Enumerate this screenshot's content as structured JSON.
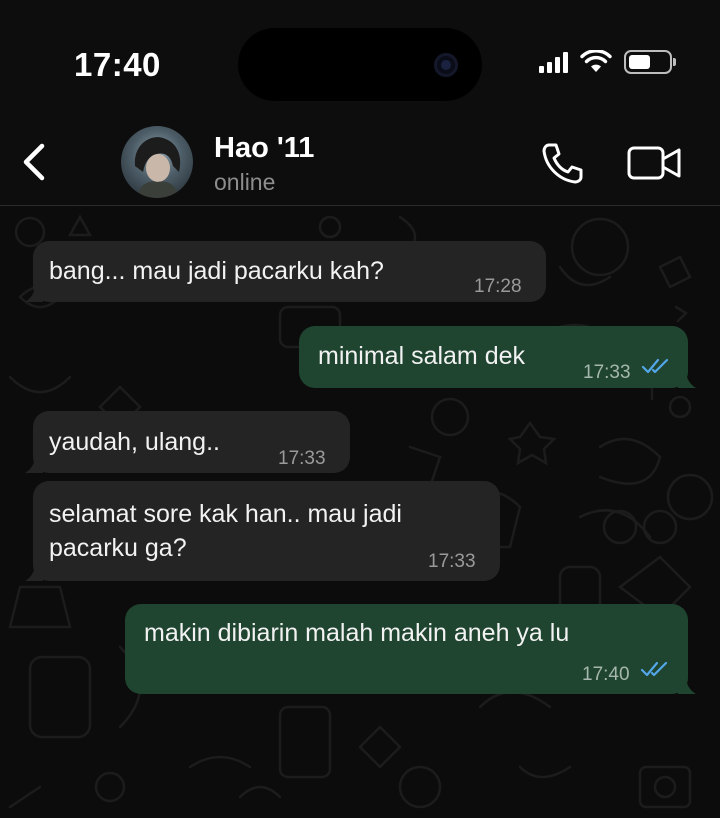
{
  "status_bar": {
    "time": "17:40"
  },
  "header": {
    "contact_name": "Hao '11",
    "contact_status": "online"
  },
  "messages": [
    {
      "direction": "incoming",
      "text": "bang... mau jadi pacarku kah?",
      "time": "17:28"
    },
    {
      "direction": "outgoing",
      "text": "minimal salam dek",
      "time": "17:33",
      "read": true
    },
    {
      "direction": "incoming",
      "text": "yaudah, ulang..",
      "time": "17:33"
    },
    {
      "direction": "incoming",
      "text": "selamat sore kak han.. mau jadi\npacarku ga?",
      "time": "17:33"
    },
    {
      "direction": "outgoing",
      "text": "makin dibiarin malah makin aneh ya lu",
      "time": "17:40",
      "read": true
    }
  ],
  "colors": {
    "incoming_bubble": "#242424",
    "outgoing_bubble": "#1f4430",
    "read_ticks": "#53a6e8",
    "background": "#0c0c0c"
  },
  "icons": [
    "back-chevron-icon",
    "phone-icon",
    "video-camera-icon",
    "signal-icon",
    "wifi-icon",
    "battery-icon",
    "double-check-icon"
  ]
}
